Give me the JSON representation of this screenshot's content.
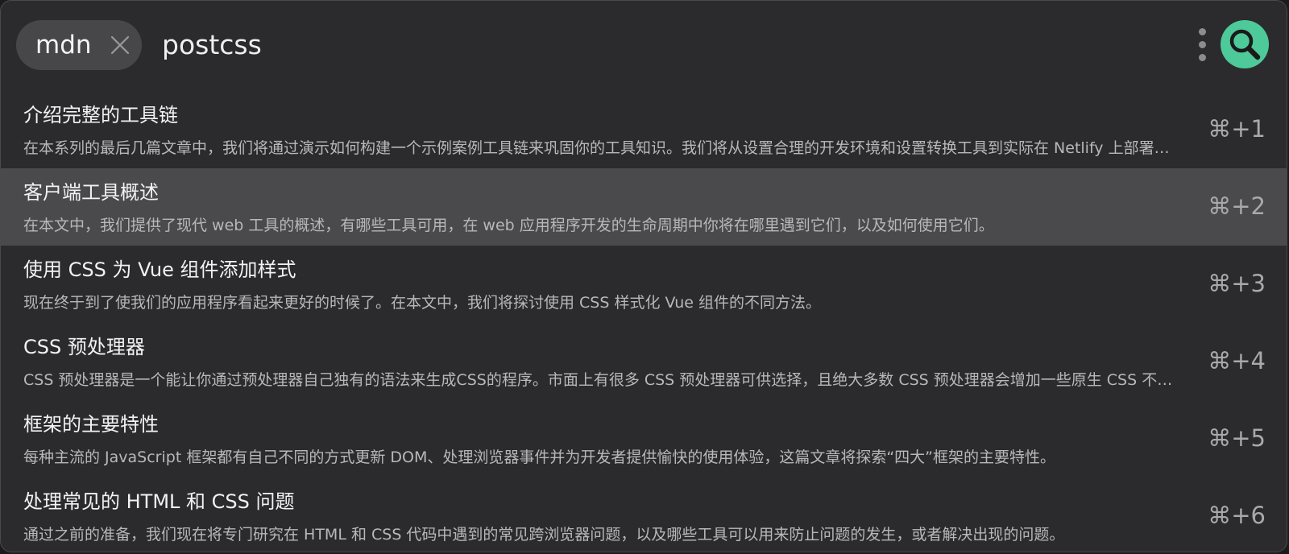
{
  "search": {
    "scope_chip": "mdn",
    "query": "postcss"
  },
  "colors": {
    "accent": "#4ec99a",
    "selected_row": "#4a4a4c",
    "background": "#2b2b2d"
  },
  "icons": {
    "chip_close": "close-icon",
    "menu": "kebab-menu-icon",
    "search": "magnifier-icon"
  },
  "results": [
    {
      "title": "介绍完整的工具链",
      "description": "在本系列的最后几篇文章中，我们将通过演示如何构建一个示例案例工具链来巩固你的工具知识。我们将从设置合理的开发环境和设置转换工具到实际在 Netlify 上部署你的应用程序。",
      "shortcut": "⌘+1",
      "selected": false
    },
    {
      "title": "客户端工具概述",
      "description": "在本文中，我们提供了现代 web 工具的概述，有哪些工具可用，在 web 应用程序开发的生命周期中你将在哪里遇到它们，以及如何使用它们。",
      "shortcut": "⌘+2",
      "selected": true
    },
    {
      "title": "使用 CSS 为 Vue 组件添加样式",
      "description": "现在终于到了使我们的应用程序看起来更好的时候了。在本文中，我们将探讨使用 CSS 样式化 Vue 组件的不同方法。",
      "shortcut": "⌘+3",
      "selected": false
    },
    {
      "title": "CSS 预处理器",
      "description": "CSS 预处理器是一个能让你通过预处理器自己独有的语法来生成CSS的程序。市面上有很多 CSS 预处理器可供选择，且绝大多数 CSS 预处理器会增加一些原生 CSS 不具备的特性。",
      "shortcut": "⌘+4",
      "selected": false
    },
    {
      "title": "框架的主要特性",
      "description": "每种主流的 JavaScript 框架都有自己不同的方式更新 DOM、处理浏览器事件并为开发者提供愉快的使用体验，这篇文章将探索“四大”框架的主要特性。",
      "shortcut": "⌘+5",
      "selected": false
    },
    {
      "title": "处理常见的 HTML 和 CSS 问题",
      "description": "通过之前的准备，我们现在将专门研究在 HTML 和 CSS 代码中遇到的常见跨浏览器问题，以及哪些工具可以用来防止问题的发生，或者解决出现的问题。",
      "shortcut": "⌘+6",
      "selected": false
    }
  ]
}
